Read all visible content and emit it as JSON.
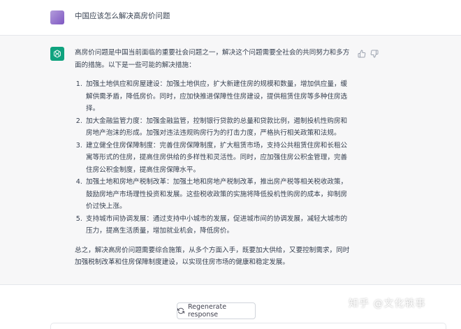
{
  "user_message": {
    "text": "中国应该怎么解决高房价问题"
  },
  "assistant_message": {
    "intro": "高房价问题是中国当前面临的重要社会问题之一，解决这个问题需要全社会的共同努力和多方面的措施。以下是一些可能的解决措施：",
    "items": [
      "加强土地供应和房屋建设：加强土地供应，扩大新建住房的规模和数量，增加供应量，缓解供需矛盾，降低房价。同时，应加快推进保障性住房建设，提供租赁住房等多种住房选择。",
      "加大金融监管力度：加强金融监管，控制银行贷款的总量和贷款比例，遏制投机性购房和房地产泡沫的形成。加强对违法违规购房行为的打击力度，严格执行相关政策和法规。",
      "建立健全住房保障制度：完善住房保障制度，扩大租赁市场，支持公共租赁住房和长租公寓等形式的住房，提高住房供给的多样性和灵活性。同时，应加强住房公积金管理，完善住房公积金制度，提高住房保障水平。",
      "加强土地和房地产税制改革：加强土地和房地产税制改革，推出房产税等相关税收政策，鼓励房地产市场理性投资和发展。这些税收政策的实施将降低投机性购房的成本，抑制房价过快上涨。",
      "支持城市间协调发展：通过支持中小城市的发展，促进城市间的协调发展，减轻大城市的压力，提高生活质量，增加就业机会，降低房价。"
    ],
    "summary": "总之，解决高房价问题需要综合施策，从多个方面入手，既要加大供给，又要控制需求，同时加强税制改革和住房保障制度建设，以实现住房市场的健康和稳定发展。"
  },
  "regenerate_label": "Regenerate response",
  "watermark": "知乎 @文化轶事",
  "colors": {
    "brand_green": "#10a37f",
    "assistant_bg": "#f7f7f8",
    "text": "#374151"
  },
  "icons": [
    "user-avatar",
    "openai-logo-icon",
    "thumbs-up-icon",
    "thumbs-down-icon",
    "refresh-icon"
  ]
}
